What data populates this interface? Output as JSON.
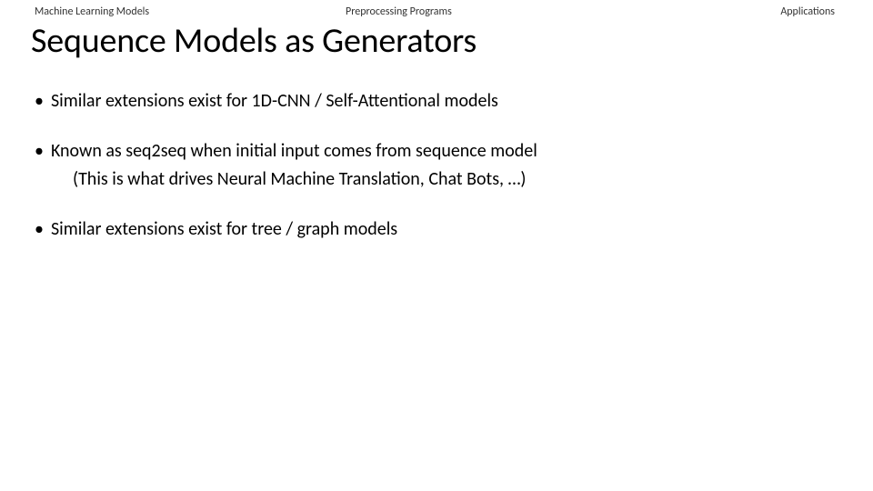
{
  "header": {
    "left": "Machine Learning Models",
    "center": "Preprocessing Programs",
    "right": "Applications"
  },
  "title": "Sequence Models as Generators",
  "bullets": {
    "b1": "Similar extensions exist for 1D-CNN / Self-Attentional models",
    "b2": "Known as seq2seq when initial input comes from sequence model",
    "b2_sub": "(This is what drives Neural Machine Translation, Chat Bots, …)",
    "b3": "Similar extensions exist for tree / graph models"
  }
}
